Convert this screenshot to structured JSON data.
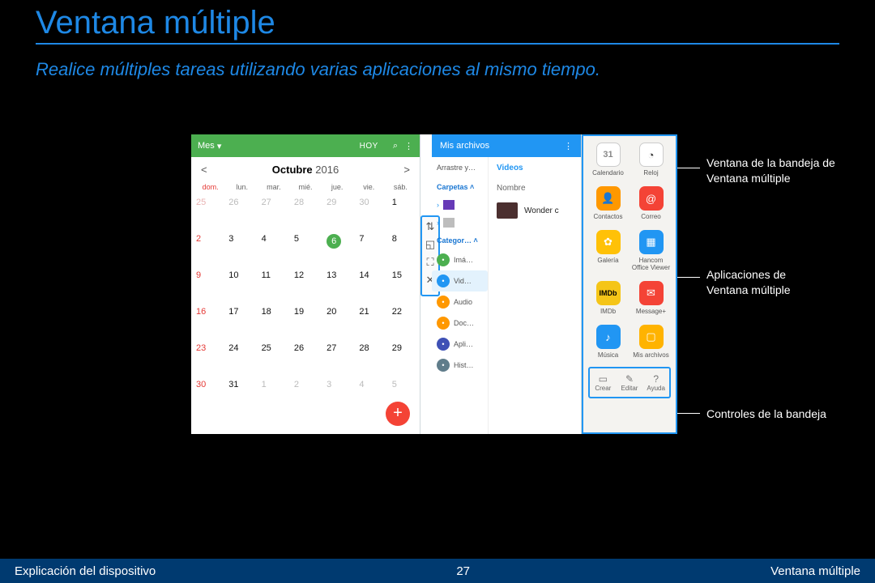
{
  "title": "Ventana múltiple",
  "subtitle": "Realice múltiples tareas utilizando varias aplicaciones al mismo tiempo.",
  "calendar": {
    "view_label": "Mes",
    "today_link": "HOY",
    "month": "Octubre",
    "year": "2016",
    "dow": [
      "dom.",
      "lun.",
      "mar.",
      "mié.",
      "jue.",
      "vie.",
      "sáb."
    ],
    "cells": [
      {
        "n": "25",
        "dim": true,
        "sun": true
      },
      {
        "n": "26",
        "dim": true
      },
      {
        "n": "27",
        "dim": true
      },
      {
        "n": "28",
        "dim": true
      },
      {
        "n": "29",
        "dim": true
      },
      {
        "n": "30",
        "dim": true
      },
      {
        "n": "1"
      },
      {
        "n": "2",
        "sun": true
      },
      {
        "n": "3"
      },
      {
        "n": "4"
      },
      {
        "n": "5"
      },
      {
        "n": "6",
        "today": true
      },
      {
        "n": "7"
      },
      {
        "n": "8"
      },
      {
        "n": "9",
        "sun": true
      },
      {
        "n": "10"
      },
      {
        "n": "11"
      },
      {
        "n": "12"
      },
      {
        "n": "13"
      },
      {
        "n": "14"
      },
      {
        "n": "15"
      },
      {
        "n": "16",
        "sun": true
      },
      {
        "n": "17"
      },
      {
        "n": "18"
      },
      {
        "n": "19"
      },
      {
        "n": "20"
      },
      {
        "n": "21"
      },
      {
        "n": "22"
      },
      {
        "n": "23",
        "sun": true
      },
      {
        "n": "24"
      },
      {
        "n": "25"
      },
      {
        "n": "26"
      },
      {
        "n": "27"
      },
      {
        "n": "28"
      },
      {
        "n": "29"
      },
      {
        "n": "30",
        "sun": true
      },
      {
        "n": "31"
      },
      {
        "n": "1",
        "dim": true
      },
      {
        "n": "2",
        "dim": true
      },
      {
        "n": "3",
        "dim": true
      },
      {
        "n": "4",
        "dim": true
      },
      {
        "n": "5",
        "dim": true
      }
    ]
  },
  "divider_icons": [
    "⇅",
    "◱",
    "⛶",
    "✕"
  ],
  "myfiles": {
    "title": "Mis archivos",
    "left": {
      "drag": "Arrastre y…",
      "folders": "Carpetas",
      "categories": "Categor…",
      "items": [
        "Imá…",
        "Vid…",
        "Audio",
        "Doc…",
        "Apli…",
        "Hist…"
      ]
    },
    "right": {
      "tab": "Videos",
      "header": "Nombre",
      "item": "Wonder c"
    }
  },
  "apps": [
    {
      "label": "Calendario",
      "cls": "c31",
      "glyph": "31"
    },
    {
      "label": "Reloj",
      "cls": "clk",
      "glyph": "◔"
    },
    {
      "label": "Contactos",
      "cls": "orng",
      "glyph": "👤"
    },
    {
      "label": "Correo",
      "cls": "red",
      "glyph": "@"
    },
    {
      "label": "Galería",
      "cls": "yell",
      "glyph": "✿"
    },
    {
      "label": "Hancom Office Viewer",
      "cls": "blue",
      "glyph": "▦"
    },
    {
      "label": "IMDb",
      "cls": "imdb",
      "glyph": "IMDb"
    },
    {
      "label": "Message+",
      "cls": "msg",
      "glyph": "✉"
    },
    {
      "label": "Música",
      "cls": "blue",
      "glyph": "♪"
    },
    {
      "label": "Mis archivos",
      "cls": "fold",
      "glyph": "▢"
    }
  ],
  "traybar": [
    {
      "icon": "▭",
      "label": "Crear"
    },
    {
      "icon": "✎",
      "label": "Editar"
    },
    {
      "icon": "?",
      "label": "Ayuda"
    }
  ],
  "callouts": {
    "c1": "Ventana de la bandeja de\nVentana múltiple",
    "c2": "Aplicaciones de\nVentana múltiple",
    "c3": "Controles de la bandeja"
  },
  "footer": {
    "left": "Explicación del dispositivo",
    "center": "27",
    "right": "Ventana múltiple"
  }
}
